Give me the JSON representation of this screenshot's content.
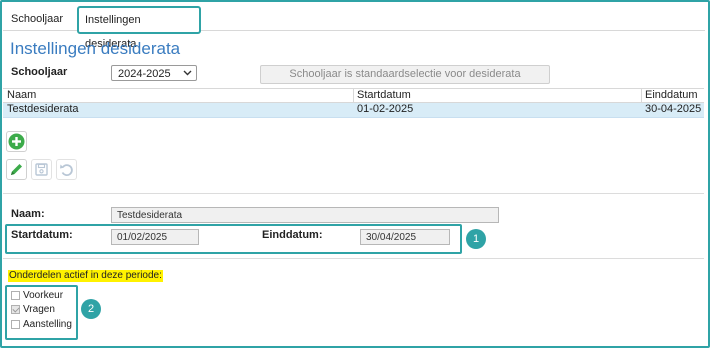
{
  "tabs": [
    {
      "label": "Schooljaar"
    },
    {
      "label": "Instellingen desiderata"
    }
  ],
  "page_title": "Instellingen desiderata",
  "schooljaar": {
    "label": "Schooljaar",
    "selected": "2024-2025",
    "default_button": "Schooljaar is standaardselectie voor desiderata"
  },
  "table": {
    "headers": [
      "Naam",
      "Startdatum",
      "Einddatum"
    ],
    "rows": [
      {
        "naam": "Testdesiderata",
        "startdatum": "01-02-2025",
        "einddatum": "30-04-2025"
      }
    ]
  },
  "form": {
    "naam_label": "Naam:",
    "naam_value": "Testdesiderata",
    "start_label": "Startdatum:",
    "start_value": "01/02/2025",
    "eind_label": "Einddatum:",
    "eind_value": "30/04/2025"
  },
  "onderdelen": {
    "heading": "Onderdelen actief in deze periode:",
    "items": [
      {
        "label": "Voorkeur",
        "checked": false
      },
      {
        "label": "Vragen",
        "checked": true
      },
      {
        "label": "Aanstelling",
        "checked": false
      }
    ]
  },
  "callouts": [
    "1",
    "2"
  ],
  "colors": {
    "accent": "#2fa3a6",
    "title": "#3a7cc0",
    "add": "#3cab4a",
    "selected_row": "#d8ecf7",
    "highlight": "#fff200"
  },
  "icons": [
    "plus-circle-icon",
    "pencil-icon",
    "save-icon",
    "undo-icon"
  ]
}
